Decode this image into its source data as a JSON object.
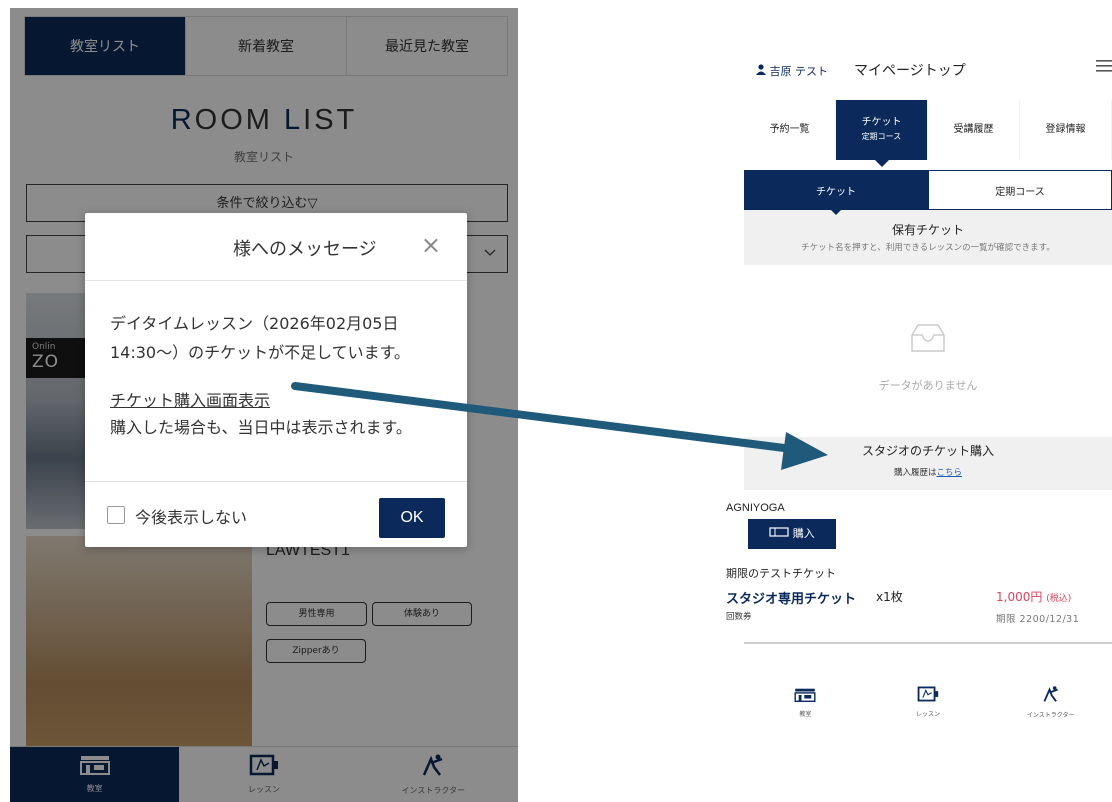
{
  "left": {
    "tabs": [
      "教室リスト",
      "新着教室",
      "最近見た教室"
    ],
    "room_list_title_first": "R",
    "room_list_title_middle": "OOM ",
    "room_list_title_l": "L",
    "room_list_title_rest": "IST",
    "room_list_subtitle": "教室リスト",
    "filter_label": "条件で絞り込む▽",
    "zoom_badge_small": "Onlin",
    "zoom_badge_big": "ZO",
    "room_name": "LAWTEST1",
    "tags": [
      "男性専用",
      "体験あり",
      "Zipperあり"
    ],
    "modal": {
      "title": "様へのメッセージ",
      "close": "×",
      "message_line1": "デイタイムレッスン（2026年02月05日",
      "message_line2": "14:30〜）のチケットが不足しています。",
      "link": "チケット購入画面表示",
      "note": "購入した場合も、当日中は表示されます。",
      "checkbox_label": "今後表示しない",
      "ok": "OK"
    },
    "bottom_nav": [
      "教室",
      "レッスン",
      "インストラクター"
    ]
  },
  "right": {
    "user_name": "吉原 テスト",
    "title": "マイページトップ",
    "tabs": [
      {
        "l1": "予約一覧",
        "l2": ""
      },
      {
        "l1": "チケット",
        "l2": "定期コース"
      },
      {
        "l1": "受講履歴",
        "l2": ""
      },
      {
        "l1": "登録情報",
        "l2": ""
      }
    ],
    "segments": [
      "チケット",
      "定期コース"
    ],
    "owned_title": "保有チケット",
    "owned_sub": "チケット名を押すと、利用できるレッスンの一覧が確認できます。",
    "empty_text": "データがありません",
    "buy_title": "スタジオのチケット購入",
    "buy_history_prefix": "購入履歴は",
    "buy_history_link": "こちら",
    "studio_name": "AGNIYOGA",
    "buy_button": "購入",
    "ticket_group": "期限のテストチケット",
    "ticket_name": "スタジオ専用チケット",
    "ticket_qty": "x1枚",
    "ticket_price": "1,000円",
    "ticket_tax": "(税込)",
    "ticket_type": "回数券",
    "ticket_expiry": "期限 2200/12/31",
    "bottom_nav": [
      "教室",
      "レッスン",
      "インストラクター"
    ]
  },
  "colors": {
    "navy": "#0b2a5b",
    "arrow": "#1f5a7a",
    "price": "#d8455f"
  },
  "icons": [
    "studio-icon",
    "lesson-icon",
    "instructor-icon",
    "person-icon",
    "hamburger-icon",
    "inbox-icon",
    "ticket-icon",
    "close-icon",
    "chevron-down-icon"
  ]
}
